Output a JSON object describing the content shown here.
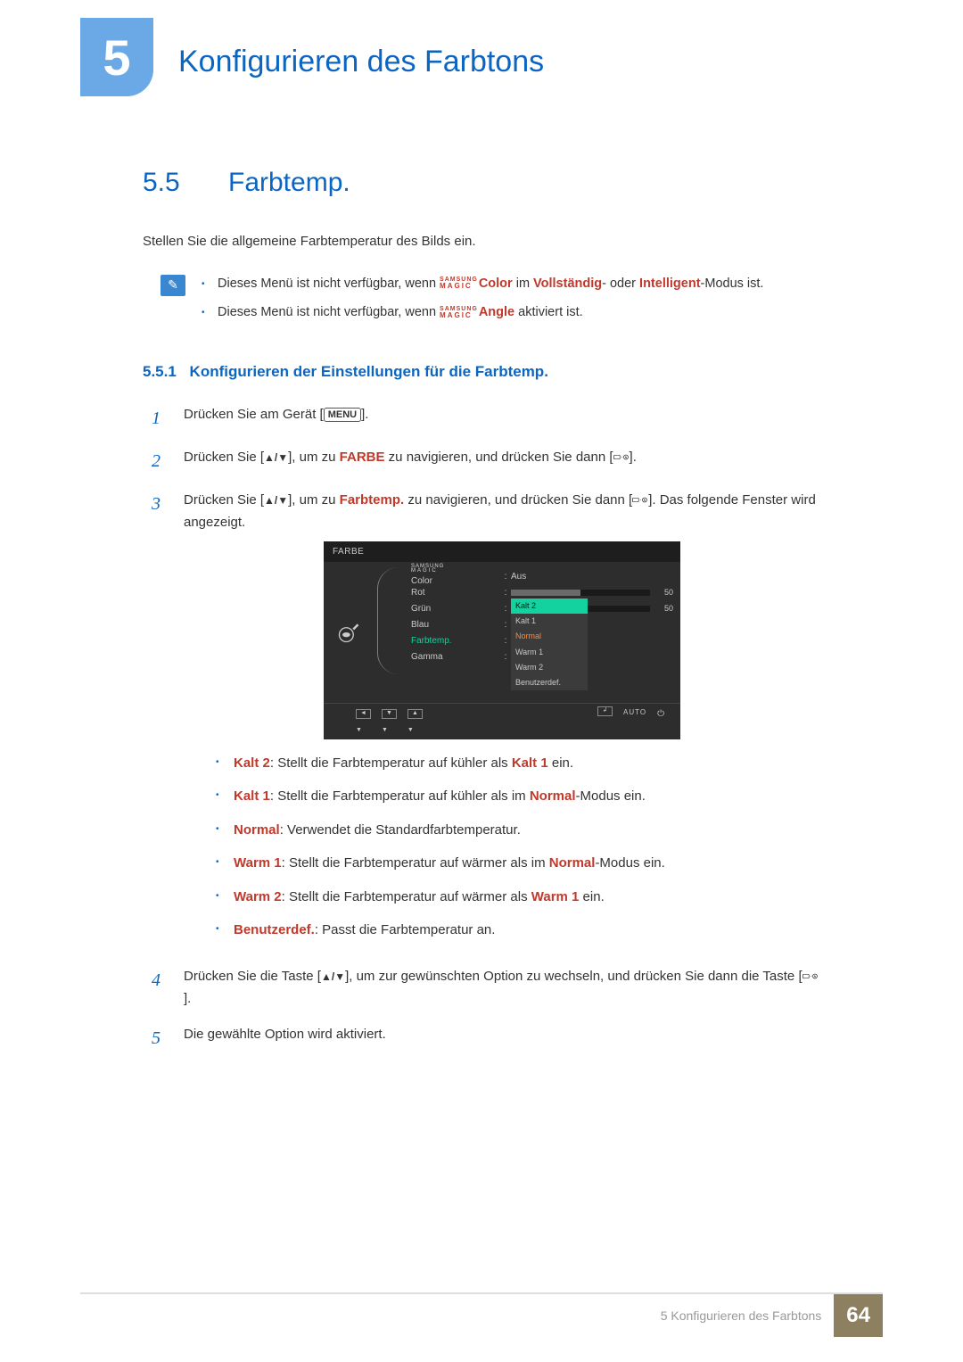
{
  "chapter": {
    "number": "5",
    "title": "Konfigurieren des Farbtons"
  },
  "section": {
    "number": "5.5",
    "title": "Farbtemp."
  },
  "intro": "Stellen Sie die allgemeine Farbtemperatur des Bilds ein.",
  "notes": {
    "n1_a": "Dieses Menü ist nicht verfügbar, wenn ",
    "n1_brand": "Color",
    "n1_b": " im ",
    "n1_mode1": "Vollständig",
    "n1_c": "- oder ",
    "n1_mode2": "Intelligent",
    "n1_d": "-Modus ist.",
    "n2_a": "Dieses Menü ist nicht verfügbar, wenn ",
    "n2_brand": "Angle",
    "n2_b": " aktiviert ist."
  },
  "subsection": {
    "number": "5.5.1",
    "title": "Konfigurieren der Einstellungen für die Farbtemp."
  },
  "steps": {
    "s1_num": "1",
    "s1_a": "Drücken Sie am Gerät [",
    "s1_menu": "MENU",
    "s1_b": "].",
    "s2_num": "2",
    "s2_a": "Drücken Sie [",
    "s2_b": "], um zu ",
    "s2_target": "FARBE",
    "s2_c": " zu navigieren, und drücken Sie dann [",
    "s2_d": "].",
    "s3_num": "3",
    "s3_a": "Drücken Sie [",
    "s3_b": "], um zu ",
    "s3_target": "Farbtemp.",
    "s3_c": " zu navigieren, und drücken Sie dann [",
    "s3_d": "]. Das folgende Fenster wird angezeigt.",
    "s4_num": "4",
    "s4_a": "Drücken Sie die Taste [",
    "s4_b": "], um zur gewünschten Option zu wechseln, und drücken Sie dann die Taste [",
    "s4_c": "].",
    "s5_num": "5",
    "s5_text": "Die gewählte Option wird aktiviert."
  },
  "osd": {
    "title": "FARBE",
    "magic_top": "SAMSUNG",
    "magic_bot": "MAGIC",
    "rows": {
      "r0_label": " Color",
      "r0_val": "Aus",
      "r1_label": "Rot",
      "r1_val": "50",
      "r2_label": "Grün",
      "r2_val": "50",
      "r3_label": "Blau",
      "r4_label": "Farbtemp.",
      "r5_label": "Gamma"
    },
    "dropdown": {
      "d0": "Kalt 2",
      "d1": "Kalt 1",
      "d2": "Normal",
      "d3": "Warm 1",
      "d4": "Warm 2",
      "d5": "Benutzerdef."
    },
    "nav": {
      "auto": "AUTO"
    }
  },
  "explanations": {
    "e1_k": "Kalt 2",
    "e1_t": ": Stellt die Farbtemperatur auf kühler als ",
    "e1_r": "Kalt 1",
    "e1_s": " ein.",
    "e2_k": "Kalt 1",
    "e2_t": ": Stellt die Farbtemperatur auf kühler als im ",
    "e2_r": "Normal",
    "e2_s": "-Modus ein.",
    "e3_k": "Normal",
    "e3_t": ": Verwendet die Standardfarbtemperatur.",
    "e4_k": "Warm 1",
    "e4_t": ": Stellt die Farbtemperatur auf wärmer als im ",
    "e4_r": "Normal",
    "e4_s": "-Modus ein.",
    "e5_k": "Warm 2",
    "e5_t": ": Stellt die Farbtemperatur auf wärmer als ",
    "e5_r": "Warm 1",
    "e5_s": " ein.",
    "e6_k": "Benutzerdef.",
    "e6_t": ": Passt die Farbtemperatur an."
  },
  "footer": {
    "text": "5 Konfigurieren des Farbtons",
    "page": "64"
  }
}
